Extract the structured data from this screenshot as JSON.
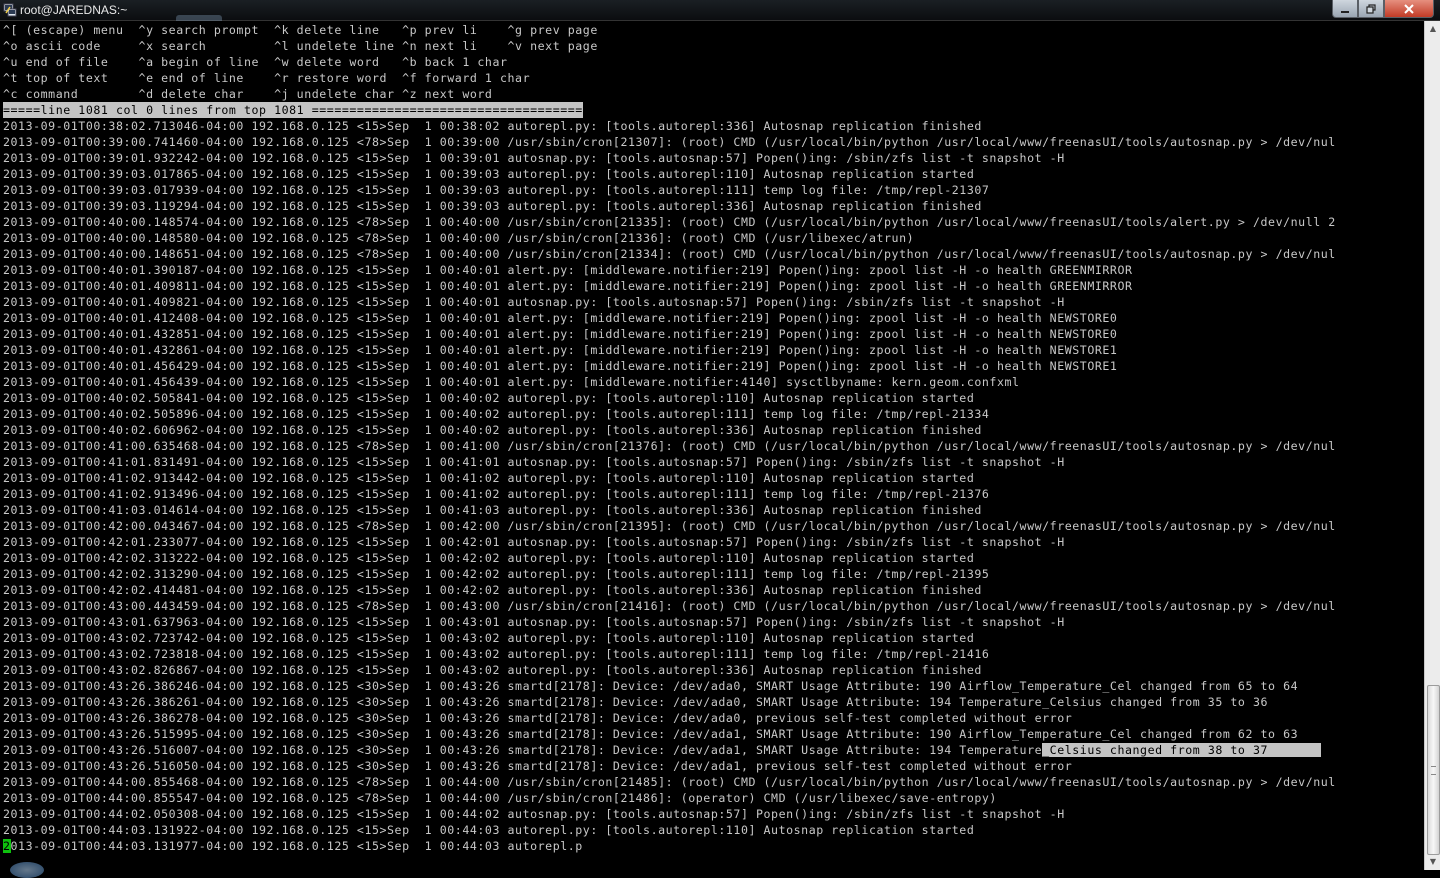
{
  "window": {
    "title": "root@JAREDNAS:~",
    "icon": "putty-icon",
    "buttons": {
      "minimize": "minimize-icon",
      "maximize": "maximize-icon",
      "close": "close-icon"
    }
  },
  "help": [
    "^[ (escape) menu  ^y search prompt  ^k delete line   ^p prev li    ^g prev page",
    "^o ascii code     ^x search         ^l undelete line ^n next li    ^v next page",
    "^u end of file    ^a begin of line  ^w delete word   ^b back 1 char",
    "^t top of text    ^e end of line    ^r restore word  ^f forward 1 char",
    "^c command        ^d delete char    ^j undelete char ^z next word"
  ],
  "status_line": "=====line 1081 col 0 lines from top 1081 ====================================",
  "log": [
    "2013-09-01T00:38:02.713046-04:00 192.168.0.125 <15>Sep  1 00:38:02 autorepl.py: [tools.autorepl:336] Autosnap replication finished",
    "2013-09-01T00:39:00.741460-04:00 192.168.0.125 <78>Sep  1 00:39:00 /usr/sbin/cron[21307]: (root) CMD (/usr/local/bin/python /usr/local/www/freenasUI/tools/autosnap.py > /dev/nul",
    "2013-09-01T00:39:01.932242-04:00 192.168.0.125 <15>Sep  1 00:39:01 autosnap.py: [tools.autosnap:57] Popen()ing: /sbin/zfs list -t snapshot -H",
    "2013-09-01T00:39:03.017865-04:00 192.168.0.125 <15>Sep  1 00:39:03 autorepl.py: [tools.autorepl:110] Autosnap replication started",
    "2013-09-01T00:39:03.017939-04:00 192.168.0.125 <15>Sep  1 00:39:03 autorepl.py: [tools.autorepl:111] temp log file: /tmp/repl-21307",
    "2013-09-01T00:39:03.119294-04:00 192.168.0.125 <15>Sep  1 00:39:03 autorepl.py: [tools.autorepl:336] Autosnap replication finished",
    "2013-09-01T00:40:00.148574-04:00 192.168.0.125 <78>Sep  1 00:40:00 /usr/sbin/cron[21335]: (root) CMD (/usr/local/bin/python /usr/local/www/freenasUI/tools/alert.py > /dev/null 2",
    "2013-09-01T00:40:00.148580-04:00 192.168.0.125 <78>Sep  1 00:40:00 /usr/sbin/cron[21336]: (root) CMD (/usr/libexec/atrun)",
    "2013-09-01T00:40:00.148651-04:00 192.168.0.125 <78>Sep  1 00:40:00 /usr/sbin/cron[21334]: (root) CMD (/usr/local/bin/python /usr/local/www/freenasUI/tools/autosnap.py > /dev/nul",
    "2013-09-01T00:40:01.390187-04:00 192.168.0.125 <15>Sep  1 00:40:01 alert.py: [middleware.notifier:219] Popen()ing: zpool list -H -o health GREENMIRROR",
    "2013-09-01T00:40:01.409811-04:00 192.168.0.125 <15>Sep  1 00:40:01 alert.py: [middleware.notifier:219] Popen()ing: zpool list -H -o health GREENMIRROR",
    "2013-09-01T00:40:01.409821-04:00 192.168.0.125 <15>Sep  1 00:40:01 autosnap.py: [tools.autosnap:57] Popen()ing: /sbin/zfs list -t snapshot -H",
    "2013-09-01T00:40:01.412408-04:00 192.168.0.125 <15>Sep  1 00:40:01 alert.py: [middleware.notifier:219] Popen()ing: zpool list -H -o health NEWSTORE0",
    "2013-09-01T00:40:01.432851-04:00 192.168.0.125 <15>Sep  1 00:40:01 alert.py: [middleware.notifier:219] Popen()ing: zpool list -H -o health NEWSTORE0",
    "2013-09-01T00:40:01.432861-04:00 192.168.0.125 <15>Sep  1 00:40:01 alert.py: [middleware.notifier:219] Popen()ing: zpool list -H -o health NEWSTORE1",
    "2013-09-01T00:40:01.456429-04:00 192.168.0.125 <15>Sep  1 00:40:01 alert.py: [middleware.notifier:219] Popen()ing: zpool list -H -o health NEWSTORE1",
    "2013-09-01T00:40:01.456439-04:00 192.168.0.125 <15>Sep  1 00:40:01 alert.py: [middleware.notifier:4140] sysctlbyname: kern.geom.confxml",
    "2013-09-01T00:40:02.505841-04:00 192.168.0.125 <15>Sep  1 00:40:02 autorepl.py: [tools.autorepl:110] Autosnap replication started",
    "2013-09-01T00:40:02.505896-04:00 192.168.0.125 <15>Sep  1 00:40:02 autorepl.py: [tools.autorepl:111] temp log file: /tmp/repl-21334",
    "2013-09-01T00:40:02.606962-04:00 192.168.0.125 <15>Sep  1 00:40:02 autorepl.py: [tools.autorepl:336] Autosnap replication finished",
    "2013-09-01T00:41:00.635468-04:00 192.168.0.125 <78>Sep  1 00:41:00 /usr/sbin/cron[21376]: (root) CMD (/usr/local/bin/python /usr/local/www/freenasUI/tools/autosnap.py > /dev/nul",
    "2013-09-01T00:41:01.831491-04:00 192.168.0.125 <15>Sep  1 00:41:01 autosnap.py: [tools.autosnap:57] Popen()ing: /sbin/zfs list -t snapshot -H",
    "2013-09-01T00:41:02.913442-04:00 192.168.0.125 <15>Sep  1 00:41:02 autorepl.py: [tools.autorepl:110] Autosnap replication started",
    "2013-09-01T00:41:02.913496-04:00 192.168.0.125 <15>Sep  1 00:41:02 autorepl.py: [tools.autorepl:111] temp log file: /tmp/repl-21376",
    "2013-09-01T00:41:03.014614-04:00 192.168.0.125 <15>Sep  1 00:41:03 autorepl.py: [tools.autorepl:336] Autosnap replication finished",
    "2013-09-01T00:42:00.043467-04:00 192.168.0.125 <78>Sep  1 00:42:00 /usr/sbin/cron[21395]: (root) CMD (/usr/local/bin/python /usr/local/www/freenasUI/tools/autosnap.py > /dev/nul",
    "2013-09-01T00:42:01.233077-04:00 192.168.0.125 <15>Sep  1 00:42:01 autosnap.py: [tools.autosnap:57] Popen()ing: /sbin/zfs list -t snapshot -H",
    "2013-09-01T00:42:02.313222-04:00 192.168.0.125 <15>Sep  1 00:42:02 autorepl.py: [tools.autorepl:110] Autosnap replication started",
    "2013-09-01T00:42:02.313290-04:00 192.168.0.125 <15>Sep  1 00:42:02 autorepl.py: [tools.autorepl:111] temp log file: /tmp/repl-21395",
    "2013-09-01T00:42:02.414481-04:00 192.168.0.125 <15>Sep  1 00:42:02 autorepl.py: [tools.autorepl:336] Autosnap replication finished",
    "2013-09-01T00:43:00.443459-04:00 192.168.0.125 <78>Sep  1 00:43:00 /usr/sbin/cron[21416]: (root) CMD (/usr/local/bin/python /usr/local/www/freenasUI/tools/autosnap.py > /dev/nul",
    "2013-09-01T00:43:01.637963-04:00 192.168.0.125 <15>Sep  1 00:43:01 autosnap.py: [tools.autosnap:57] Popen()ing: /sbin/zfs list -t snapshot -H",
    "2013-09-01T00:43:02.723742-04:00 192.168.0.125 <15>Sep  1 00:43:02 autorepl.py: [tools.autorepl:110] Autosnap replication started",
    "2013-09-01T00:43:02.723818-04:00 192.168.0.125 <15>Sep  1 00:43:02 autorepl.py: [tools.autorepl:111] temp log file: /tmp/repl-21416",
    "2013-09-01T00:43:02.826867-04:00 192.168.0.125 <15>Sep  1 00:43:02 autorepl.py: [tools.autorepl:336] Autosnap replication finished",
    "2013-09-01T00:43:26.386246-04:00 192.168.0.125 <30>Sep  1 00:43:26 smartd[2178]: Device: /dev/ada0, SMART Usage Attribute: 190 Airflow_Temperature_Cel changed from 65 to 64",
    "2013-09-01T00:43:26.386261-04:00 192.168.0.125 <30>Sep  1 00:43:26 smartd[2178]: Device: /dev/ada0, SMART Usage Attribute: 194 Temperature_Celsius changed from 35 to 36",
    "2013-09-01T00:43:26.386278-04:00 192.168.0.125 <30>Sep  1 00:43:26 smartd[2178]: Device: /dev/ada0, previous self-test completed without error",
    "2013-09-01T00:43:26.515995-04:00 192.168.0.125 <30>Sep  1 00:43:26 smartd[2178]: Device: /dev/ada1, SMART Usage Attribute: 190 Airflow_Temperature_Cel changed from 62 to 63",
    {
      "pre": "2013-09-01T00:43:26.516007-04:00 192.168.0.125 <30>Sep  1 00:43:26 smartd[2178]: Device: /dev/ada1, SMART Usage Attribute: 194 Temperature",
      "selected": "_Celsius changed from 38 to 37       "
    },
    "2013-09-01T00:43:26.516050-04:00 192.168.0.125 <30>Sep  1 00:43:26 smartd[2178]: Device: /dev/ada1, previous self-test completed without error",
    "2013-09-01T00:44:00.855468-04:00 192.168.0.125 <78>Sep  1 00:44:00 /usr/sbin/cron[21485]: (root) CMD (/usr/local/bin/python /usr/local/www/freenasUI/tools/autosnap.py > /dev/nul",
    "2013-09-01T00:44:00.855547-04:00 192.168.0.125 <78>Sep  1 00:44:00 /usr/sbin/cron[21486]: (operator) CMD (/usr/libexec/save-entropy)",
    "2013-09-01T00:44:02.050308-04:00 192.168.0.125 <15>Sep  1 00:44:02 autosnap.py: [tools.autosnap:57] Popen()ing: /sbin/zfs list -t snapshot -H",
    "2013-09-01T00:44:03.131922-04:00 192.168.0.125 <15>Sep  1 00:44:03 autorepl.py: [tools.autorepl:110] Autosnap replication started",
    {
      "cursor": "2",
      "rest": "013-09-01T00:44:03.131977-04:00 192.168.0.125 <15>Sep  1 00:44:03 autorepl.p"
    }
  ],
  "scrollbar": {
    "up": "▲",
    "down": "▼",
    "position_fraction": 0.92
  },
  "colors": {
    "text": "#c8c8c8",
    "background": "#000000",
    "highlight": "#c4c4c4",
    "cursor": "#0ec10e"
  }
}
